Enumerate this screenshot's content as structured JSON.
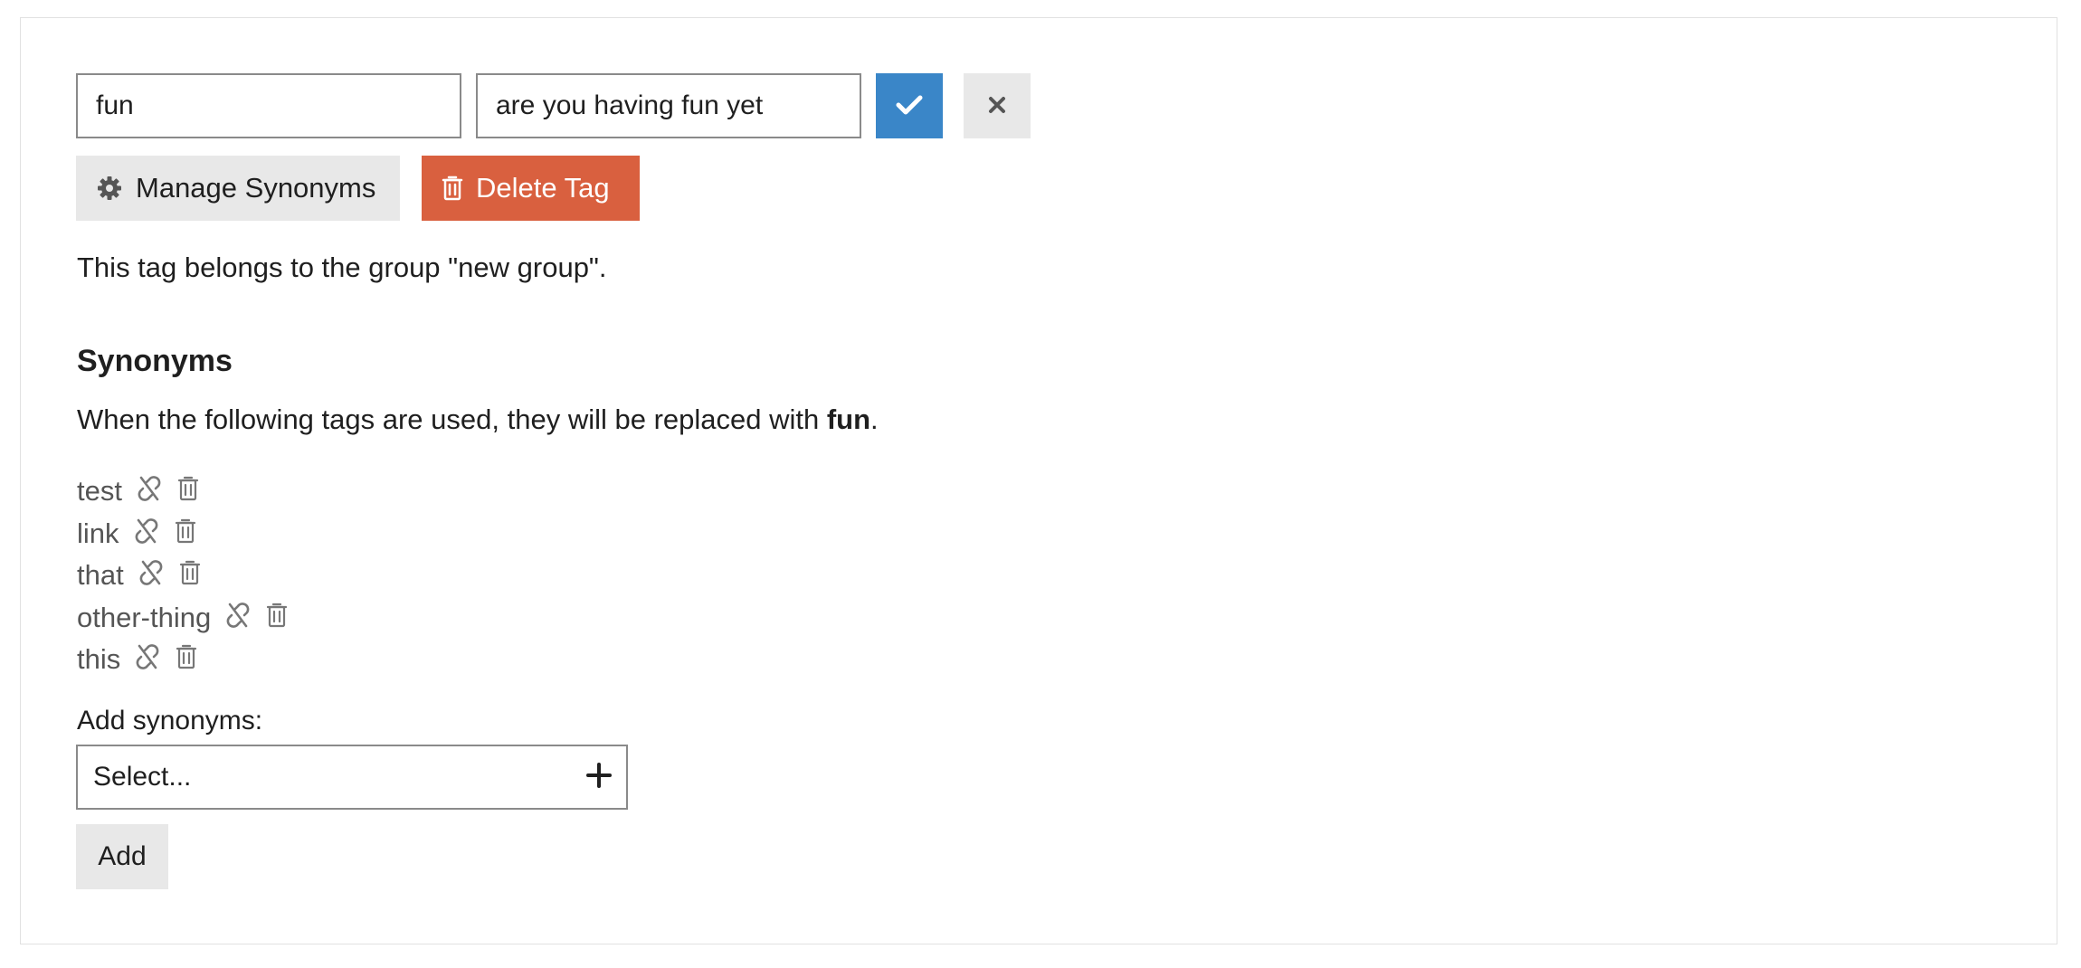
{
  "tag_editor": {
    "name_value": "fun",
    "description_value": "are you having fun yet",
    "confirm_icon": "check-icon",
    "cancel_icon": "close-icon"
  },
  "actions": {
    "manage_label": "Manage Synonyms",
    "manage_icon": "gear-icon",
    "delete_label": "Delete Tag",
    "delete_icon": "trash-icon"
  },
  "group_note": "This tag belongs to the group \"new group\".",
  "synonyms": {
    "heading": "Synonyms",
    "desc_prefix": "When the following tags are used, they will be replaced with ",
    "desc_tag": "fun",
    "desc_suffix": ".",
    "items": [
      {
        "label": "test"
      },
      {
        "label": "link"
      },
      {
        "label": "that"
      },
      {
        "label": "other-thing"
      },
      {
        "label": "this"
      }
    ],
    "item_icons": [
      "unlink-icon",
      "trash-icon"
    ]
  },
  "add_synonyms": {
    "label": "Add synonyms:",
    "select_placeholder": "Select...",
    "select_icon": "plus-icon",
    "add_button": "Add"
  },
  "colors": {
    "confirm": "#3a86c8",
    "delete": "#d9603f",
    "neutral_button": "#e8e8e8",
    "muted_text": "#555555"
  }
}
